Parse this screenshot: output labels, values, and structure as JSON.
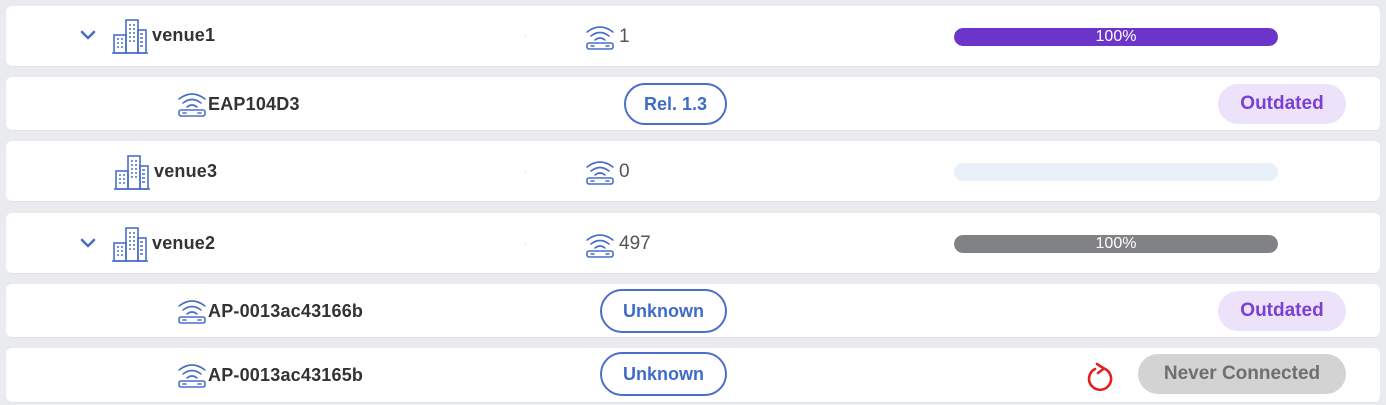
{
  "colors": {
    "bar_purple": "#6c35c9",
    "bar_gray": "#808285",
    "bar_empty": "#eaf0fa",
    "pill_blue": "#4a6fc9",
    "outdated_bg": "#ece3fb",
    "outdated_text": "#7b3fd3",
    "never_bg": "#d3d3d3",
    "refresh_red": "#e02020"
  },
  "rows": [
    {
      "type": "venue",
      "name": "venue1",
      "expanded": true,
      "ap_count": "1",
      "progress": 1.0,
      "progress_label": "100%",
      "bar_color": "#6c35c9"
    },
    {
      "type": "ap",
      "name": "EAP104D3",
      "firmware": "Rel. 1.3",
      "status": "Outdated"
    },
    {
      "type": "venue",
      "name": "venue3",
      "expanded": false,
      "ap_count": "0",
      "progress": 0.0,
      "progress_label": ""
    },
    {
      "type": "venue",
      "name": "venue2",
      "expanded": true,
      "ap_count": "497",
      "progress": 1.0,
      "progress_label": "100%",
      "bar_color": "#808285"
    },
    {
      "type": "ap",
      "name": "AP-0013ac43166b",
      "firmware": "Unknown",
      "status": "Outdated"
    },
    {
      "type": "ap",
      "name": "AP-0013ac43165b",
      "firmware": "Unknown",
      "status": "Never Connected",
      "refresh_icon": "refresh-icon"
    }
  ]
}
